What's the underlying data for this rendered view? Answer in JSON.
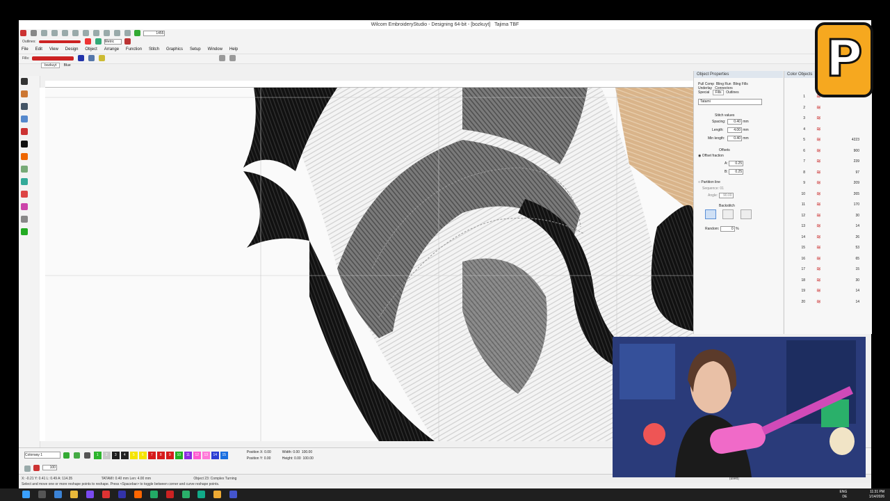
{
  "app": {
    "title": "Wilcom EmbroideryStudio - Designing 64-bit - [bozkuyt]",
    "machine": "Tajima TBF",
    "tabs": [
      "bozkuyt",
      "Blue"
    ]
  },
  "toolbar": {
    "outlines_label": "Outlines:",
    "fills_label": "Fills:",
    "stitch_count": "1455",
    "metric_label": "Metric"
  },
  "menu": [
    "File",
    "Edit",
    "View",
    "Design",
    "Object",
    "Arrange",
    "Function",
    "Stitch",
    "Graphics",
    "Setup",
    "Window",
    "Help"
  ],
  "object_properties": {
    "title": "Object Properties",
    "tabs_row1": [
      "Pull Comp",
      "Bling Run",
      "Bling Fills"
    ],
    "tabs_row2": [
      "Underlay",
      "Connectors"
    ],
    "tabs_row3": [
      "Special",
      "Fills",
      "Outlines"
    ],
    "fill_type": "Tatami",
    "stitch_values_label": "Stitch values",
    "spacing_label": "Spacing:",
    "spacing_value": "0.40",
    "length_label": "Length:",
    "length_value": "4.00",
    "min_length_label": "Min length:",
    "min_length_value": "0.40",
    "unit": "mm",
    "offsets_label": "Offsets",
    "offset_fraction_label": "Offset fraction",
    "a_label": "A:",
    "a_value": "0.25",
    "b_label": "B:",
    "b_value": "0.25",
    "partition_label": "Partition line",
    "sequence_label": "Sequence:",
    "sequence_value": "01",
    "angle_label": "Angle:",
    "angle_value": "90.00",
    "backstitch_label": "Backstitch",
    "random_label": "Random:",
    "random_value": "0",
    "percent": "%"
  },
  "color_objects": {
    "title": "Color Objects",
    "rows": [
      {
        "num": "1",
        "count": ""
      },
      {
        "num": "2",
        "count": ""
      },
      {
        "num": "3",
        "count": ""
      },
      {
        "num": "4",
        "count": ""
      },
      {
        "num": "5",
        "count": "4223"
      },
      {
        "num": "6",
        "count": "900"
      },
      {
        "num": "7",
        "count": "239"
      },
      {
        "num": "8",
        "count": "97"
      },
      {
        "num": "9",
        "count": "209"
      },
      {
        "num": "10",
        "count": "265"
      },
      {
        "num": "11",
        "count": "170"
      },
      {
        "num": "12",
        "count": "30"
      },
      {
        "num": "13",
        "count": "14"
      },
      {
        "num": "14",
        "count": "26"
      },
      {
        "num": "15",
        "count": "53"
      },
      {
        "num": "16",
        "count": "65"
      },
      {
        "num": "17",
        "count": "15"
      },
      {
        "num": "18",
        "count": "30"
      },
      {
        "num": "19",
        "count": "14"
      },
      {
        "num": "20",
        "count": "14"
      }
    ]
  },
  "bottom": {
    "colorway": "Colorway 1",
    "swatches": [
      {
        "n": "1",
        "color": "#2db52d"
      },
      {
        "n": "2",
        "color": "#c8c8c8"
      },
      {
        "n": "3",
        "color": "#1e1e1e"
      },
      {
        "n": "4",
        "color": "#222222"
      },
      {
        "n": "5",
        "color": "#f5e400"
      },
      {
        "n": "6",
        "color": "#f5e400"
      },
      {
        "n": "7",
        "color": "#d61c1c"
      },
      {
        "n": "8",
        "color": "#d61c1c"
      },
      {
        "n": "9",
        "color": "#d61c1c"
      },
      {
        "n": "10",
        "color": "#22b022"
      },
      {
        "n": "11",
        "color": "#8a2be2"
      },
      {
        "n": "12",
        "color": "#ff5ad0"
      },
      {
        "n": "13",
        "color": "#ff79d8"
      },
      {
        "n": "14",
        "color": "#2c3fd4"
      },
      {
        "n": "15",
        "color": "#1a6fe0"
      }
    ],
    "position_x_label": "Position X:",
    "position_y_label": "Position Y:",
    "width_label": "Width:",
    "height_label": "Height:",
    "pos_x": "0.00",
    "pos_y": "0.00",
    "width": "0.00",
    "height": "0.00",
    "pct1": "100.00",
    "pct2": "100.00",
    "zoom": "100"
  },
  "status": {
    "coords": "X: -0.21  Y: 0.41  L: 0.49  A: 114.35",
    "stitch_info": "TATAMI: 0.40 mm Len: 4.00 mm",
    "object": "Object 23: Complex Turning",
    "hint": "Select and move one or more reshape points to reshape. Press <Spacebar> to toggle between corner and curve reshape points.",
    "used": "(used)"
  },
  "taskbar": {
    "lang": "ENG",
    "region": "DE",
    "time": "11:31 PM",
    "date": "1/14/2026"
  },
  "logo_letter": "P"
}
